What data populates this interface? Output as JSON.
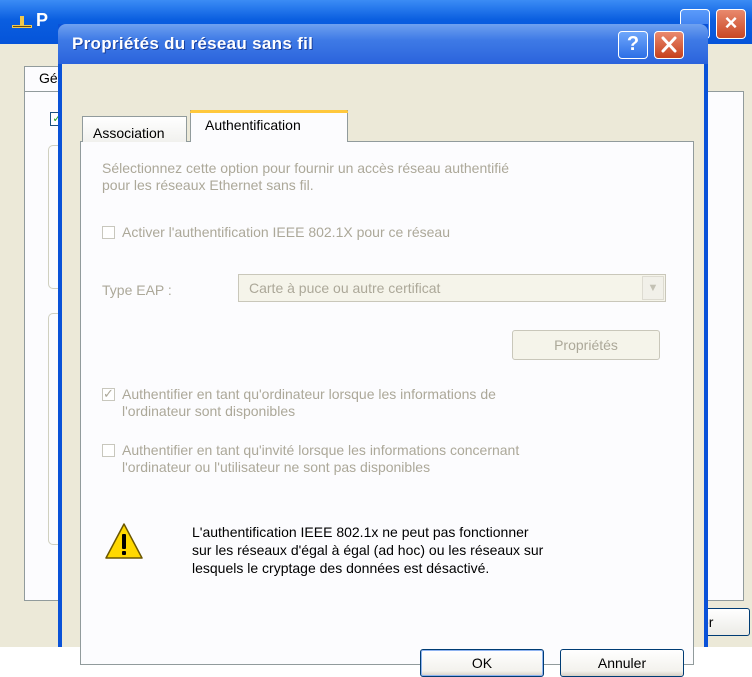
{
  "background_window": {
    "title": "P",
    "tab_label": "Gé",
    "button_fragment": "er",
    "close_glyph": "×"
  },
  "dialog": {
    "title": "Propriétés du réseau sans fil",
    "help_glyph": "?",
    "tabs": [
      {
        "label": "Association",
        "active": false
      },
      {
        "label": "Authentification",
        "active": true
      }
    ],
    "intro_text_line1": "Sélectionnez cette option pour fournir un accès réseau authentifié",
    "intro_text_line2": "pour les réseaux Ethernet sans fil.",
    "enable_8021x": {
      "label": "Activer l'authentification IEEE 802.1X pour ce réseau",
      "checked": false,
      "enabled": false
    },
    "eap_type": {
      "label": "Type EAP :",
      "value": "Carte à puce ou autre certificat",
      "enabled": false
    },
    "properties_button": "Propriétés",
    "auth_as_computer": {
      "line1": "Authentifier en tant qu'ordinateur lorsque les informations de",
      "line2": "l'ordinateur sont disponibles",
      "checked": true,
      "enabled": false
    },
    "auth_as_guest": {
      "line1": "Authentifier en tant qu'invité lorsque les informations concernant",
      "line2": "l'ordinateur ou l'utilisateur ne sont pas disponibles",
      "checked": false,
      "enabled": false
    },
    "warning": {
      "icon": "warning-icon",
      "line1": "L'authentification IEEE 802.1x ne peut pas fonctionner",
      "line2": "sur les réseaux d'égal à égal (ad hoc) ou les réseaux sur",
      "line3": "lesquels le cryptage des données est désactivé."
    },
    "ok_button": "OK",
    "cancel_button": "Annuler",
    "colors": {
      "title_bar": "#2b63dc",
      "client": "#ece9d8",
      "disabled_text": "#aca899",
      "tab_highlight": "#ffc83c"
    }
  }
}
